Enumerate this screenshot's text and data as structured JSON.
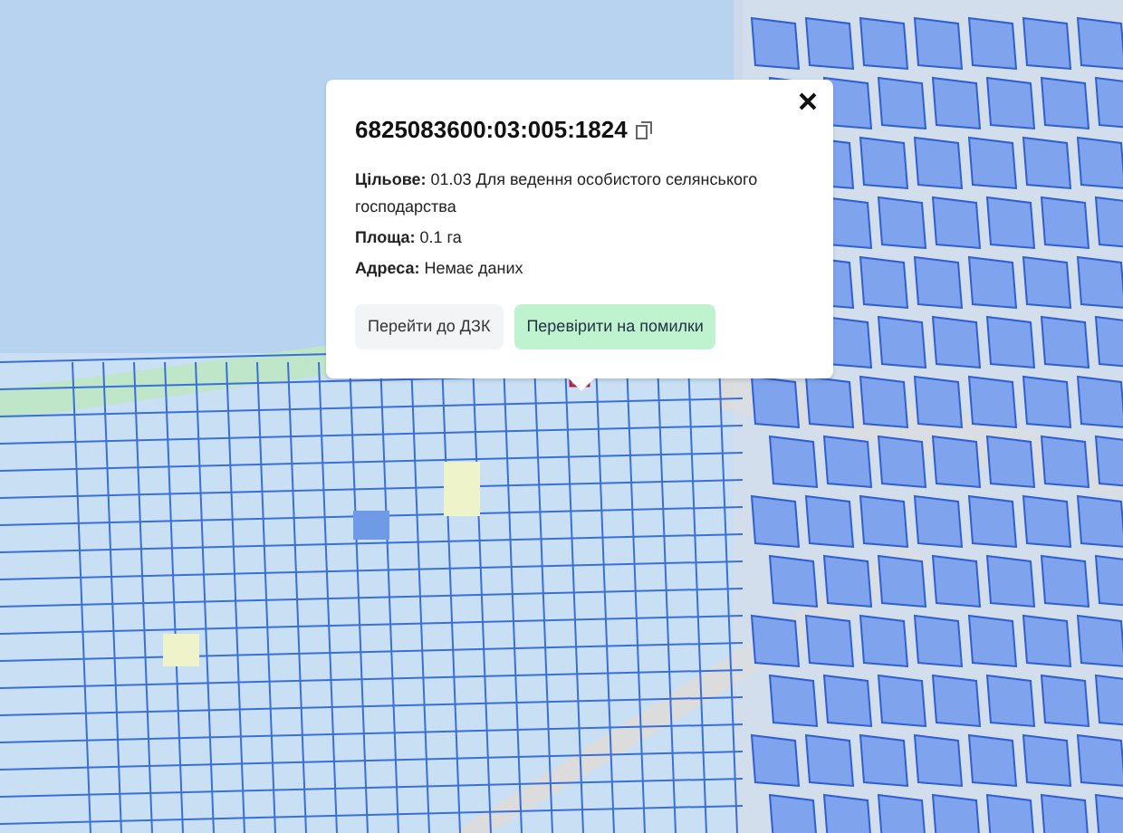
{
  "popup": {
    "title": "6825083600:03:005:1824",
    "fields": [
      "**Цільове:** 01.03 Для ведення особистого селянського господарства",
      "**Площа:** 0.1 га",
      "**Адреса:** Немає даних"
    ],
    "buttons": [
      {
        "label": "Перейти до ДЗК",
        "kind": "plain"
      },
      {
        "label": "Перевірити на помилки",
        "kind": "accent"
      }
    ]
  }
}
